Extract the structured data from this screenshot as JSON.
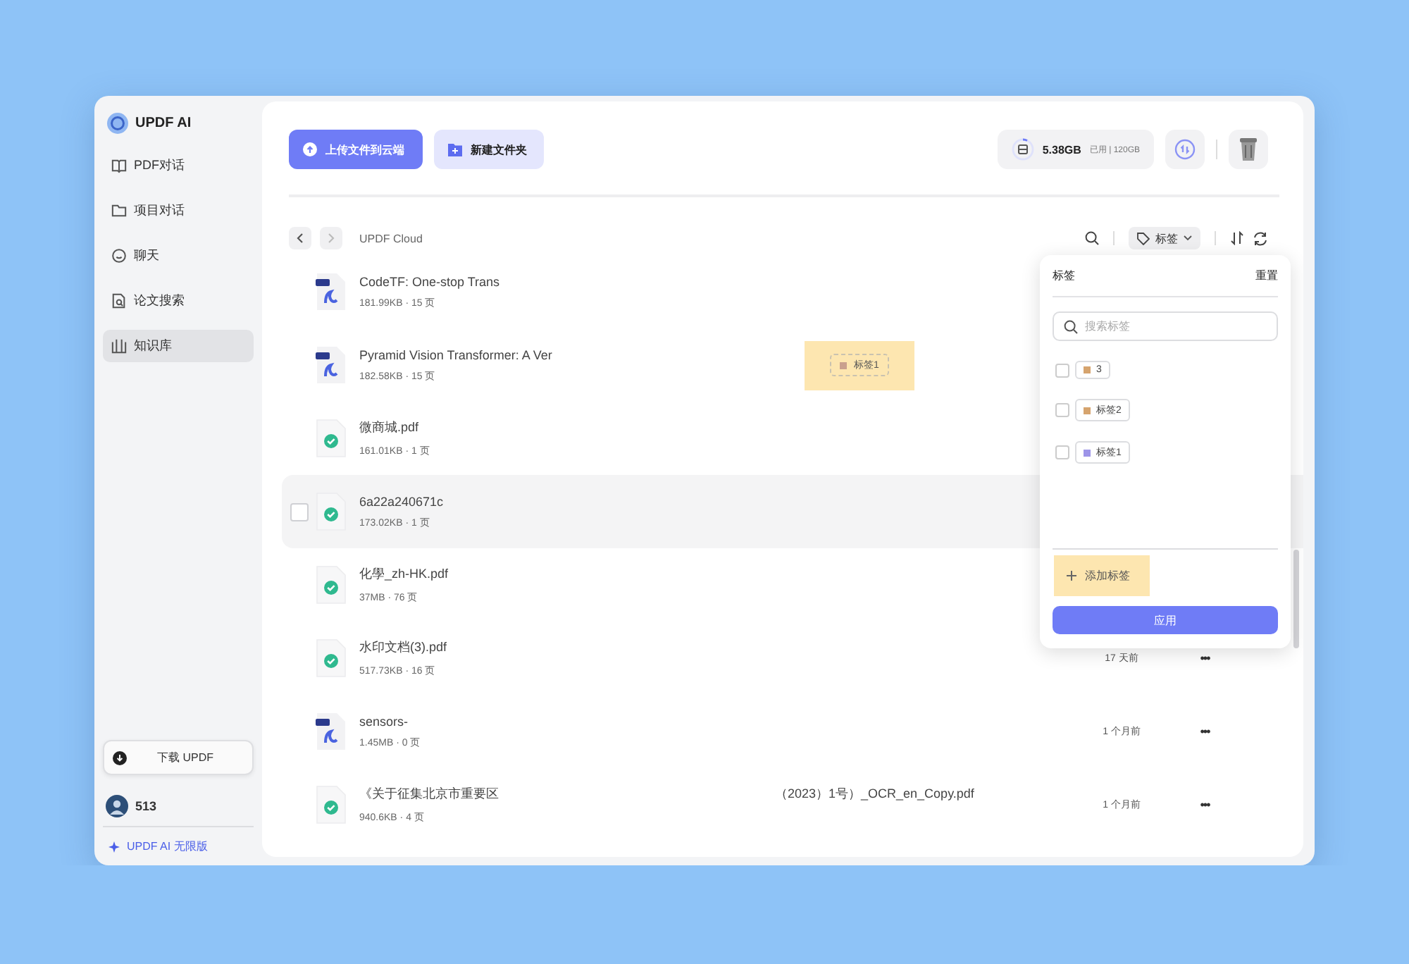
{
  "sidebar": {
    "logo": "UPDF AI",
    "items": [
      {
        "label": "PDF对话",
        "selected": false
      },
      {
        "label": "项目对话",
        "selected": false
      },
      {
        "label": "聊天",
        "selected": false
      },
      {
        "label": "论文搜索",
        "selected": false
      },
      {
        "label": "知识库",
        "selected": true
      }
    ],
    "download_button": "下载 UPDF",
    "user": {
      "name": "513"
    },
    "plan_link": "UPDF AI 无限版"
  },
  "toolbar": {
    "upload_button": "上传文件到云端",
    "new_folder_button": "新建文件夹",
    "storage": {
      "used": "5.38GB",
      "detail": "已用 | 120GB"
    }
  },
  "breadcrumb": "UPDF Cloud",
  "filter": {
    "label": "标签"
  },
  "files": [
    {
      "kind": "pdf",
      "name": "CodeTF: One-stop Trans",
      "meta": "181.99KB · 15 页",
      "hovered": false
    },
    {
      "kind": "pdf",
      "name": "Pyramid Vision Transformer: A Ver",
      "meta": "182.58KB · 15 页",
      "hovered": false,
      "tags": [
        {
          "label": "标签1",
          "color": "#c9a08e",
          "highlighted": true
        }
      ]
    },
    {
      "kind": "done",
      "name": "微商城.pdf",
      "meta": "161.01KB · 1 页",
      "hovered": false
    },
    {
      "kind": "done",
      "name": "6a22a240671c",
      "meta": "173.02KB · 1 页",
      "hovered": true
    },
    {
      "kind": "done",
      "name": "化學_zh-HK.pdf",
      "meta": "37MB · 76 页",
      "hovered": false
    },
    {
      "kind": "done",
      "name": "水印文档(3).pdf",
      "meta": "517.73KB · 16 页",
      "hovered": false,
      "date": "17 天前",
      "more": "•••"
    },
    {
      "kind": "pdf",
      "name": "sensors-",
      "meta": "1.45MB · 0 页",
      "hovered": false,
      "date": "1 个月前",
      "more": "•••"
    },
    {
      "kind": "done",
      "name": "《关于征集北京市重要区",
      "name_end": "（2023）1号）_OCR_en_Copy.pdf",
      "meta": "940.6KB · 4 页",
      "hovered": false,
      "date": "1 个月前",
      "more": "•••"
    }
  ],
  "tag_popup": {
    "title": "标签",
    "reset": "重置",
    "search_placeholder": "搜索标签",
    "tags": [
      {
        "label": "3",
        "color": "#d6a46e",
        "checked": false
      },
      {
        "label": "标签2",
        "color": "#d6a46e",
        "checked": false
      },
      {
        "label": "标签1",
        "color": "#9d94e8",
        "checked": false
      }
    ],
    "add_button": {
      "label": "添加标签",
      "highlighted": true
    },
    "apply_button": "应用"
  }
}
